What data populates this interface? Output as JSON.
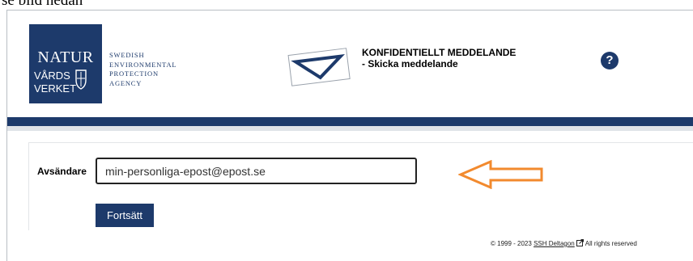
{
  "caption": "se bild nedan",
  "logo": {
    "line1": "NATUR",
    "line2": "VÅRDS",
    "line3": "VERKET",
    "sub": [
      "SWEDISH",
      "ENVIRONMENTAL",
      "PROTECTION",
      "AGENCY"
    ]
  },
  "header": {
    "title_line1": "KONFIDENTIELLT MEDDELANDE",
    "title_line2": "- Skicka meddelande",
    "help_label": "?"
  },
  "form": {
    "sender_label": "Avsändare",
    "sender_value": "min-personliga-epost@epost.se",
    "submit_label": "Fortsätt"
  },
  "footer": {
    "copyright": "© 1999 - 2023",
    "link_text": "SSH Deltagon",
    "rights": "All rights reserved"
  },
  "colors": {
    "brand": "#1d3a6b",
    "arrow": "#f28a2e"
  }
}
